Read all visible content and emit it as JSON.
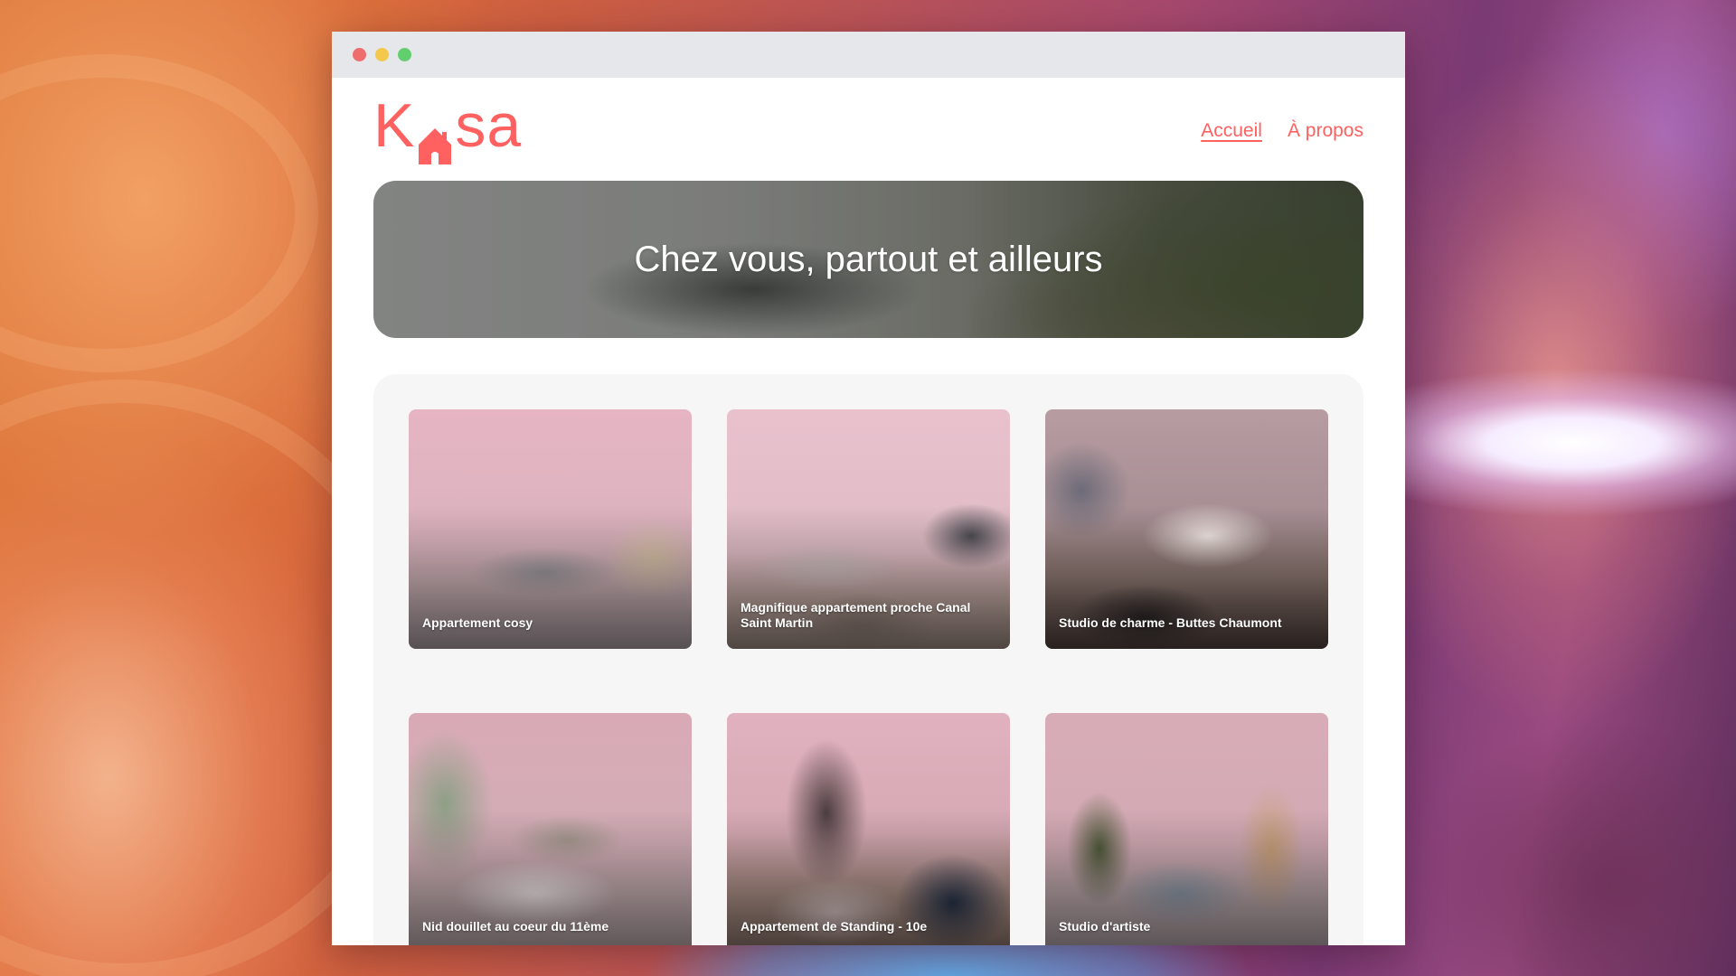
{
  "window": {
    "controls": [
      "close",
      "minimize",
      "maximize"
    ],
    "dot_colors": [
      "#ef6d6d",
      "#f4c84d",
      "#62cf6f"
    ]
  },
  "brand": {
    "logo_letters": [
      "K",
      "sa"
    ],
    "logo_icon": "house-icon",
    "accent_color": "#ff6060"
  },
  "nav": {
    "items": [
      {
        "label": "Accueil",
        "active": true
      },
      {
        "label": "À propos",
        "active": false
      }
    ]
  },
  "banner": {
    "title": "Chez vous, partout et ailleurs"
  },
  "listings": [
    {
      "title": "Appartement cosy"
    },
    {
      "title": "Magnifique appartement proche Canal Saint Martin"
    },
    {
      "title": "Studio de charme - Buttes Chaumont"
    },
    {
      "title": "Nid douillet au coeur du 11ème"
    },
    {
      "title": "Appartement de Standing - 10e"
    },
    {
      "title": "Studio d'artiste"
    }
  ]
}
